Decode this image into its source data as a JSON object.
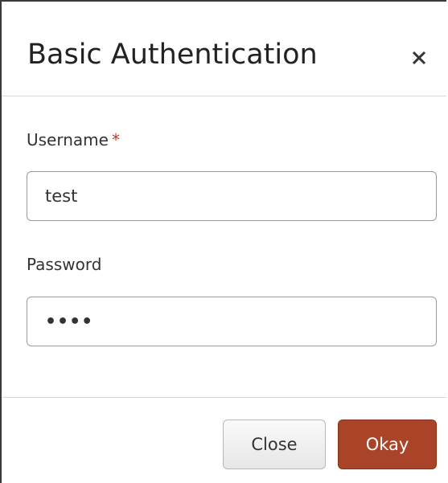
{
  "dialog": {
    "title": "Basic Authentication",
    "close_icon": "close-icon"
  },
  "form": {
    "username_label": "Username",
    "username_required_mark": "*",
    "username_value": "test",
    "password_label": "Password",
    "password_value": "test"
  },
  "footer": {
    "close_label": "Close",
    "okay_label": "Okay"
  },
  "colors": {
    "okay_button_bg": "#a94428",
    "required_star": "#c0392b"
  }
}
